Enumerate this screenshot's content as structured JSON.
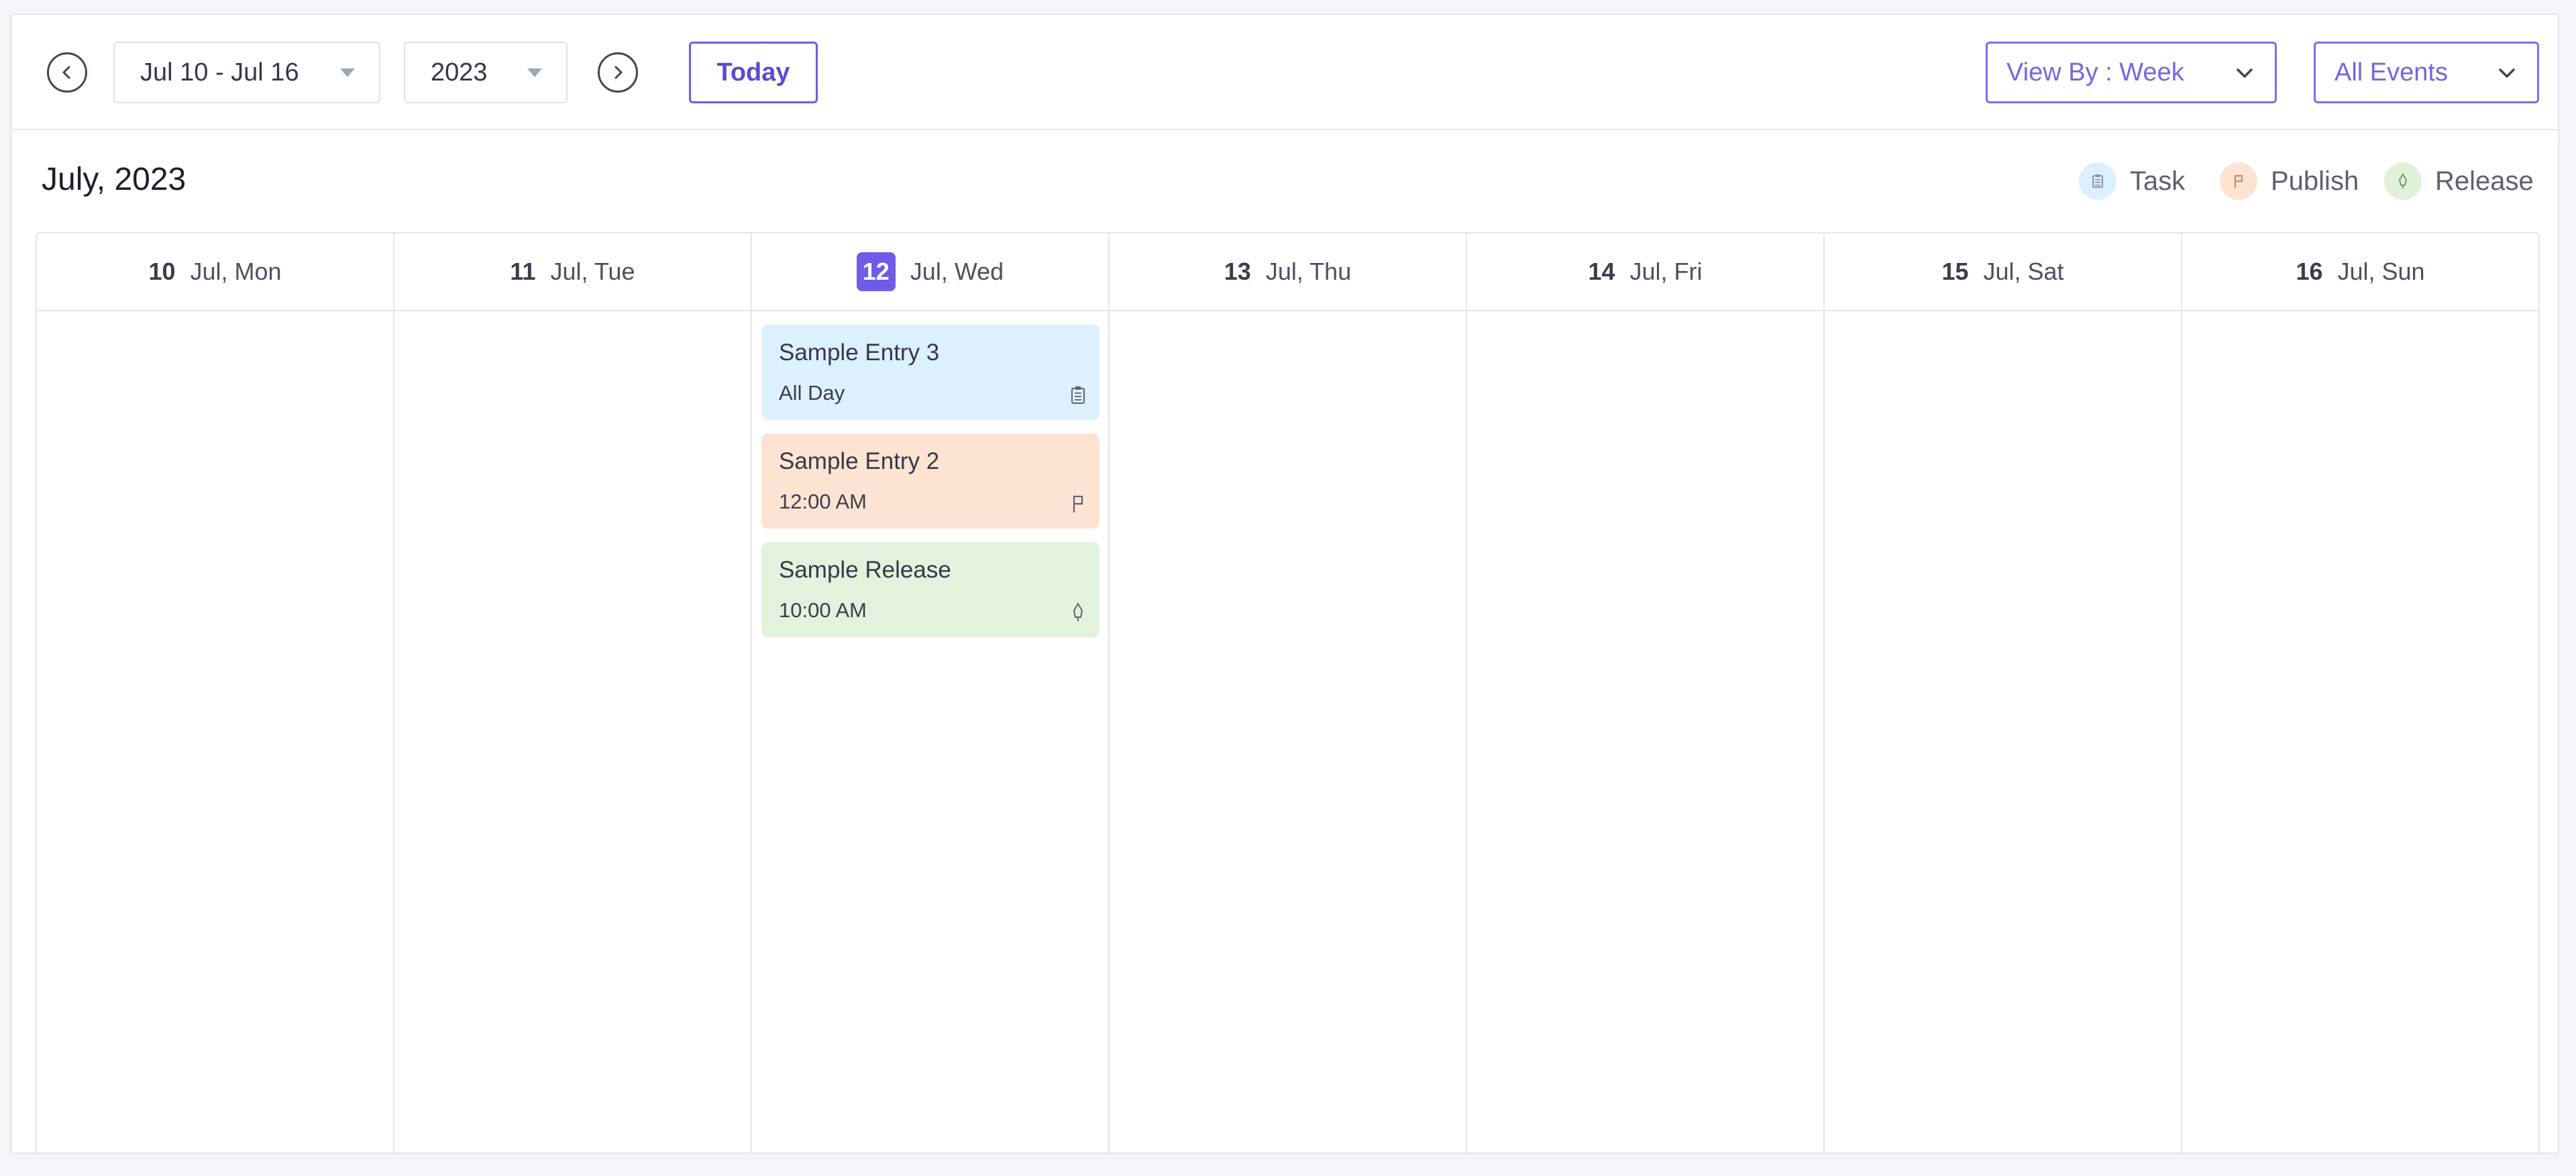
{
  "toolbar": {
    "week_range": "Jul 10 - Jul 16",
    "year": "2023",
    "today_label": "Today",
    "view_by_label": "View By : Week",
    "filter_label": "All Events"
  },
  "calendar": {
    "month_title": "July, 2023",
    "legend": [
      {
        "label": "Task",
        "color": "#dcefff",
        "icon": "clipboard-icon"
      },
      {
        "label": "Publish",
        "color": "#fde3d2",
        "icon": "flag-icon"
      },
      {
        "label": "Release",
        "color": "#e0f1d9",
        "icon": "rocket-icon"
      }
    ],
    "days": [
      {
        "num": "10",
        "label": "Jul, Mon",
        "today": false
      },
      {
        "num": "11",
        "label": "Jul, Tue",
        "today": false
      },
      {
        "num": "12",
        "label": "Jul, Wed",
        "today": true
      },
      {
        "num": "13",
        "label": "Jul, Thu",
        "today": false
      },
      {
        "num": "14",
        "label": "Jul, Fri",
        "today": false
      },
      {
        "num": "15",
        "label": "Jul, Sat",
        "today": false
      },
      {
        "num": "16",
        "label": "Jul, Sun",
        "today": false
      }
    ],
    "events": [
      {
        "title": "Sample Entry 3",
        "time": "All Day",
        "type": "task",
        "color": "#dcf0fd",
        "icon": "clipboard-icon"
      },
      {
        "title": "Sample Entry 2",
        "time": "12:00 AM",
        "type": "publish",
        "color": "#fde3d2",
        "icon": "flag-icon"
      },
      {
        "title": "Sample Release",
        "time": "10:00 AM",
        "type": "release",
        "color": "#e2f2dc",
        "icon": "rocket-icon"
      }
    ]
  },
  "colors": {
    "accent": "#6c5ce7",
    "border": "#e3e5ec"
  }
}
